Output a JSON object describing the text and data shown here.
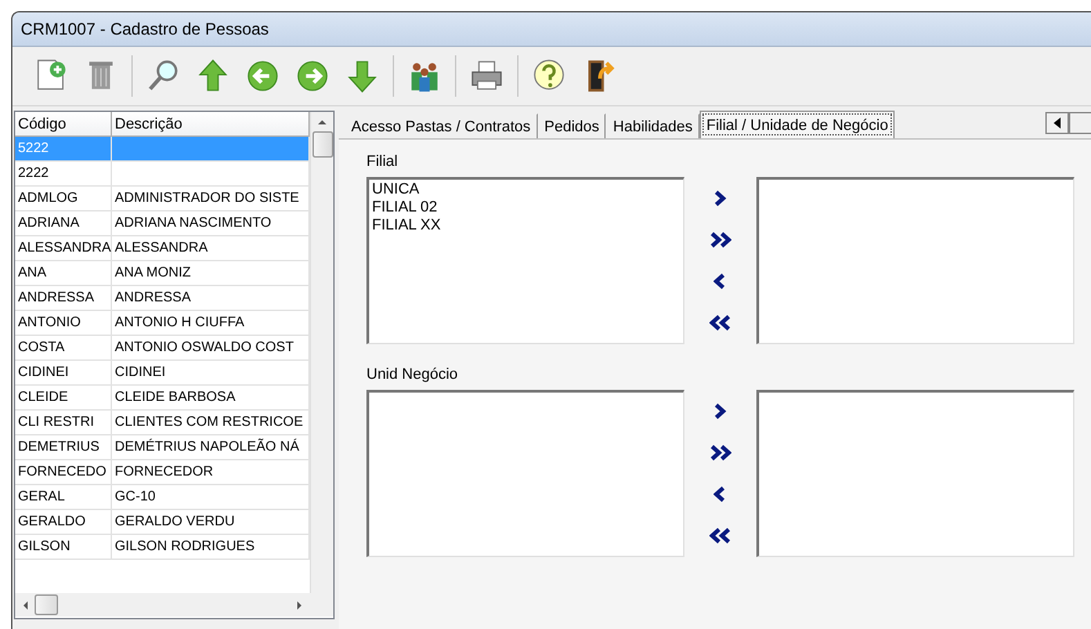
{
  "window": {
    "title": "CRM1007 - Cadastro de Pessoas"
  },
  "table": {
    "columns": [
      "Código",
      "Descrição"
    ],
    "rows": [
      {
        "codigo": "5222",
        "descricao": "",
        "selected": true
      },
      {
        "codigo": "2222",
        "descricao": "",
        "selected": false
      },
      {
        "codigo": "ADMLOG",
        "descricao": "ADMINISTRADOR DO SISTE",
        "selected": false
      },
      {
        "codigo": "ADRIANA",
        "descricao": "ADRIANA NASCIMENTO",
        "selected": false
      },
      {
        "codigo": "ALESSANDRA",
        "descricao": "ALESSANDRA",
        "selected": false
      },
      {
        "codigo": "ANA",
        "descricao": "ANA MONIZ",
        "selected": false
      },
      {
        "codigo": "ANDRESSA",
        "descricao": "ANDRESSA",
        "selected": false
      },
      {
        "codigo": "ANTONIO",
        "descricao": "ANTONIO H CIUFFA",
        "selected": false
      },
      {
        "codigo": "COSTA",
        "descricao": "ANTONIO OSWALDO COST",
        "selected": false
      },
      {
        "codigo": "CIDINEI",
        "descricao": "CIDINEI",
        "selected": false
      },
      {
        "codigo": "CLEIDE",
        "descricao": "CLEIDE BARBOSA",
        "selected": false
      },
      {
        "codigo": "CLI RESTRI",
        "descricao": "CLIENTES COM RESTRICOE",
        "selected": false
      },
      {
        "codigo": "DEMETRIUS",
        "descricao": "DEMÉTRIUS NAPOLEÃO NÁ",
        "selected": false
      },
      {
        "codigo": "FORNECEDO",
        "descricao": "FORNECEDOR",
        "selected": false
      },
      {
        "codigo": "GERAL",
        "descricao": "GC-10",
        "selected": false
      },
      {
        "codigo": "GERALDO",
        "descricao": "GERALDO VERDU",
        "selected": false
      },
      {
        "codigo": "GILSON",
        "descricao": "GILSON RODRIGUES",
        "selected": false
      }
    ]
  },
  "tabs": [
    {
      "label": "Acesso Pastas / Contratos",
      "selected": false
    },
    {
      "label": "Pedidos",
      "selected": false
    },
    {
      "label": "Habilidades",
      "selected": false
    },
    {
      "label": "Filial / Unidade de Negócio",
      "selected": true
    }
  ],
  "sections": [
    {
      "label": "Filial",
      "available": [
        "UNICA",
        "FILIAL 02",
        "FILIAL XX"
      ]
    },
    {
      "label": "Unid Negócio"
    }
  ]
}
